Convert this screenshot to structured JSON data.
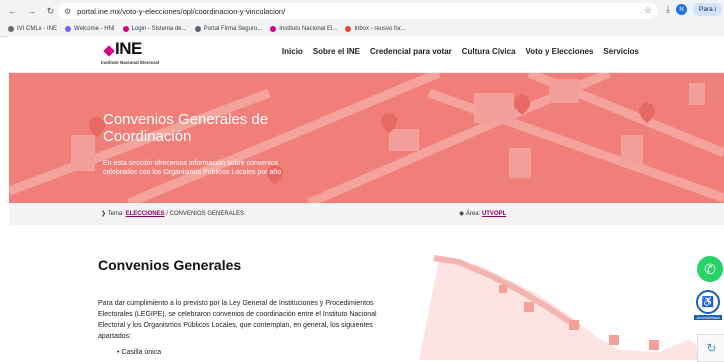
{
  "browser": {
    "url": "portal.ine.mx/voto-y-elecciones/opl/coordinacion-y-vinculacion/",
    "profile_initial": "N",
    "profile_label": "Para i"
  },
  "bookmarks": [
    {
      "label": "IVI CMLx - INE",
      "color": "#6b6b6b"
    },
    {
      "label": "Welcome - HNI",
      "color": "#7b5cff"
    },
    {
      "label": "Login - Sistema de...",
      "color": "#d5007f"
    },
    {
      "label": "Portal Firma Seguro...",
      "color": "#5f6368"
    },
    {
      "label": "Instituto Nacional El...",
      "color": "#d5007f"
    },
    {
      "label": "Inbox - reusvo for...",
      "color": "#ea4335"
    }
  ],
  "site": {
    "logo_word": "INE",
    "logo_sub": "Instituto Nacional Electoral",
    "menu": [
      "Inicio",
      "Sobre el INE",
      "Credencial para votar",
      "Cultura Cívica",
      "Voto y Elecciones",
      "Servicios"
    ]
  },
  "hero": {
    "title": "Convenios Generales de Coordinación",
    "description": "En esta sección ofrecemos información sobre convenios celebrados con los Organismos Públicos Locales por año",
    "bg_color": "#f17f79"
  },
  "breadcrumb": {
    "prefix": "Tema:",
    "link": "ELECCIONES",
    "sep": "/",
    "current": "CONVENIOS GENERALES",
    "area_prefix": "Área:",
    "area_link": "UTVOPL"
  },
  "content": {
    "title": "Convenios Generales",
    "body": "Para dar cumplimiento a lo previsto por la Ley General de Instituciones y Procedimientos Electorales (LEGIPE), se celebraron convenios de coordinación entre el Instituto Nacional Electoral y los Organismos Públicos Locales, que contemplan, en general, los siguientes apartados:",
    "bullets": [
      "Casilla única"
    ]
  },
  "widgets": {
    "accessibility_label": "Accesibilidad"
  }
}
